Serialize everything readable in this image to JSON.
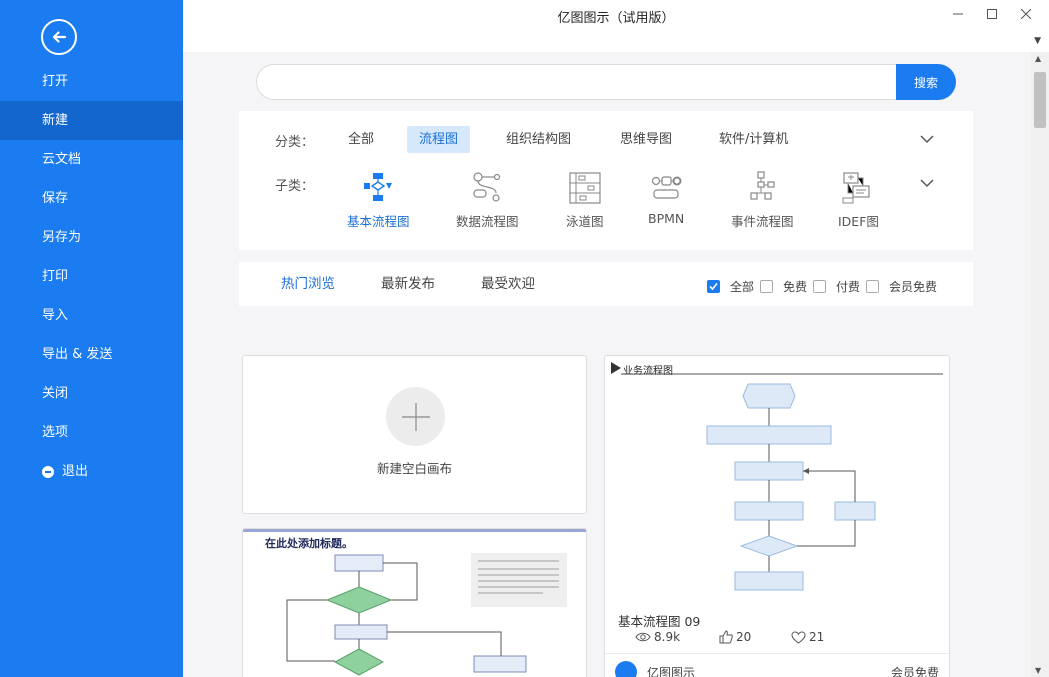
{
  "window": {
    "title": "亿图图示（试用版）"
  },
  "sidebar": {
    "items": [
      {
        "label": "打开",
        "active": false
      },
      {
        "label": "新建",
        "active": true
      },
      {
        "label": "云文档",
        "active": false
      },
      {
        "label": "保存",
        "active": false
      },
      {
        "label": "另存为",
        "active": false
      },
      {
        "label": "打印",
        "active": false
      },
      {
        "label": "导入",
        "active": false
      },
      {
        "label": "导出 & 发送",
        "active": false
      },
      {
        "label": "关闭",
        "active": false
      },
      {
        "label": "选项",
        "active": false
      },
      {
        "label": "退出",
        "active": false
      }
    ]
  },
  "search": {
    "placeholder": "",
    "value": "",
    "button_label": "搜索"
  },
  "category": {
    "label": "分类：",
    "items": [
      "全部",
      "流程图",
      "组织结构图",
      "思维导图",
      "软件/计算机"
    ],
    "selected": "流程图"
  },
  "subcategory": {
    "label": "子类：",
    "items": [
      {
        "label": "基本流程图",
        "icon": "basic-flowchart-icon"
      },
      {
        "label": "数据流程图",
        "icon": "data-flow-icon"
      },
      {
        "label": "泳道图",
        "icon": "swimlane-icon"
      },
      {
        "label": "BPMN",
        "icon": "bpmn-icon"
      },
      {
        "label": "事件流程图",
        "icon": "event-flow-icon"
      },
      {
        "label": "IDEF图",
        "icon": "idef-icon"
      }
    ],
    "selected": "基本流程图"
  },
  "tabs": {
    "items": [
      "热门浏览",
      "最新发布",
      "最受欢迎"
    ],
    "selected": "热门浏览"
  },
  "filters": [
    {
      "label": "全部",
      "checked": true
    },
    {
      "label": "免费",
      "checked": false
    },
    {
      "label": "付费",
      "checked": false
    },
    {
      "label": "会员免费",
      "checked": false
    }
  ],
  "new_blank": {
    "label": "新建空白画布"
  },
  "template_left": {
    "heading": "在此处添加标题。"
  },
  "template_right": {
    "diagram_title": "业务流程图",
    "name": "基本流程图 09",
    "views": "8.9k",
    "likes": "20",
    "favorites": "21",
    "author": "亿图图示",
    "price_tag": "会员免费"
  },
  "colors": {
    "sidebar": "#1a7cf0",
    "sidebar_active": "#1466cf",
    "accent": "#1a6fd6",
    "selected_category_bg": "#d6e8fb"
  }
}
